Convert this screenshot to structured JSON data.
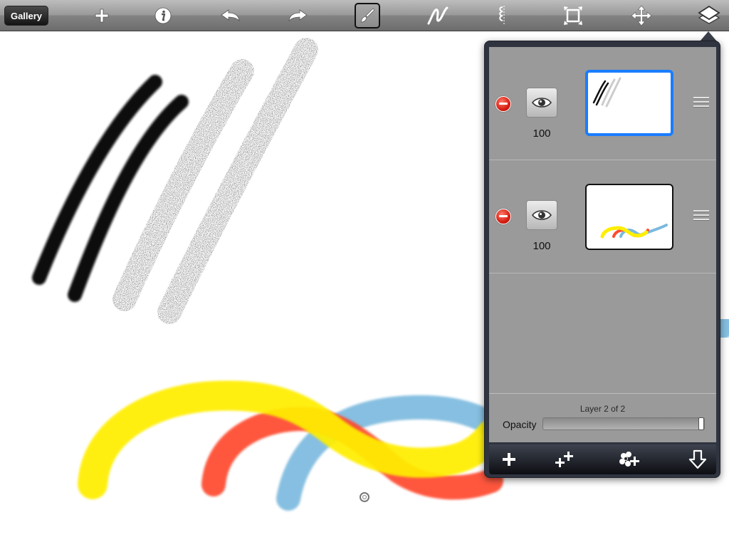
{
  "toolbar": {
    "gallery_label": "Gallery",
    "icons": [
      "add-icon",
      "info-icon",
      "undo-icon",
      "redo-icon",
      "brush-icon",
      "smudge-icon",
      "eraser-icon",
      "transform-icon",
      "move-icon",
      "layers-icon"
    ],
    "selected_tool": "brush-icon"
  },
  "colors": {
    "stroke_black": "#111111",
    "stroke_yellow": "#ffee00",
    "stroke_red": "#ff4a2e",
    "stroke_blue": "#7ab9de",
    "selection_blue": "#1a7dff"
  },
  "layers_panel": {
    "layers": [
      {
        "opacity": "100",
        "selected": true
      },
      {
        "opacity": "100",
        "selected": false
      }
    ],
    "layer_count": "Layer 2 of 2",
    "opacity_label": "Opacity",
    "opacity_value": 1.0,
    "footer_icons": [
      "add-layer-icon",
      "duplicate-layer-icon",
      "import-photo-icon",
      "merge-down-icon"
    ]
  }
}
